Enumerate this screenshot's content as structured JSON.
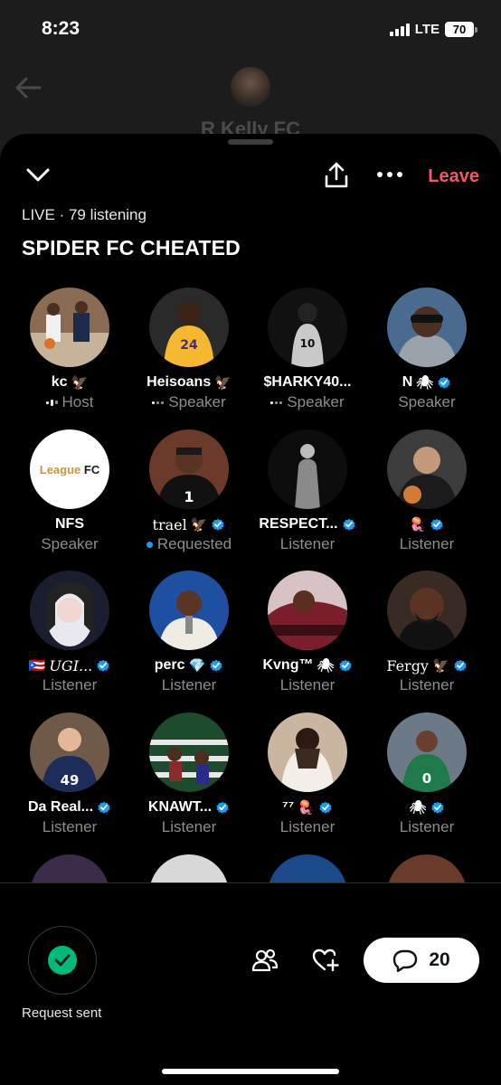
{
  "status": {
    "time": "8:23",
    "network": "LTE",
    "battery": "70"
  },
  "background": {
    "title": "R Kelly FC"
  },
  "space": {
    "leave_label": "Leave",
    "meta": "LIVE · 79 listening",
    "title": "SPIDER FC CHEATED"
  },
  "participants": [
    {
      "name": "kc",
      "badge": "🦅",
      "role": "Host",
      "status_icon": "speaking-bars-icon",
      "verified": false
    },
    {
      "name": "Heisoans",
      "badge": "🦅",
      "role": "Speaker",
      "status_icon": "muted-dots-icon",
      "verified": false
    },
    {
      "name": "$HARKY40...",
      "badge": "",
      "role": "Speaker",
      "status_icon": "muted-dots-icon",
      "verified": false
    },
    {
      "name": "N",
      "badge": "🕷",
      "role": "Speaker",
      "status_icon": "",
      "verified": true
    },
    {
      "name": "NFS",
      "badge": "",
      "role": "Speaker",
      "status_icon": "",
      "verified": false,
      "avatar_text": "League FC"
    },
    {
      "name": "trael",
      "badge": "🦅",
      "role": "Requested",
      "status_icon": "requested-dot-icon",
      "verified": true
    },
    {
      "name": "RESPECT...",
      "badge": "",
      "role": "Listener",
      "status_icon": "",
      "verified": true
    },
    {
      "name": "",
      "badge": "🪼",
      "role": "Listener",
      "status_icon": "",
      "verified": true
    },
    {
      "name": "UGI...",
      "badge": "🇵🇷",
      "role": "Listener",
      "status_icon": "",
      "verified": true
    },
    {
      "name": "perc",
      "badge": "💎",
      "role": "Listener",
      "status_icon": "",
      "verified": true
    },
    {
      "name": "Kvng™",
      "badge": "🕷",
      "role": "Listener",
      "status_icon": "",
      "verified": true
    },
    {
      "name": "Fergy",
      "badge": "🦅",
      "role": "Listener",
      "status_icon": "",
      "verified": true
    },
    {
      "name": "Da Real...",
      "badge": "",
      "role": "Listener",
      "status_icon": "",
      "verified": true
    },
    {
      "name": "KNAWT...",
      "badge": "",
      "role": "Listener",
      "status_icon": "",
      "verified": true
    },
    {
      "name": "⁷⁷",
      "badge": "🪼",
      "role": "Listener",
      "status_icon": "",
      "verified": true
    },
    {
      "name": "",
      "badge": "🕷",
      "role": "Listener",
      "status_icon": "",
      "verified": true
    }
  ],
  "footer": {
    "request_label": "Request sent",
    "comment_count": "20"
  },
  "colors": {
    "accent": "#1d9bf0",
    "leave": "#f4595f",
    "success": "#00ba7c",
    "muted": "#8a8d91"
  }
}
